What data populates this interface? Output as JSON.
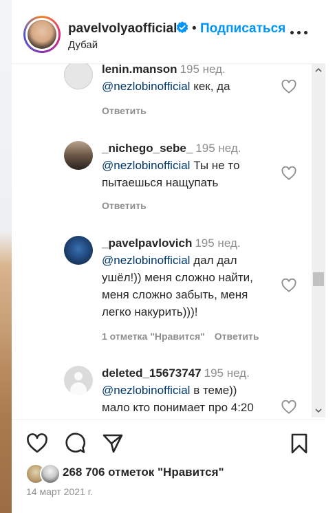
{
  "header": {
    "username": "pavelvolyaofficial",
    "separator": "•",
    "follow_label": "Подписаться",
    "location": "Дубай",
    "avatar_icon": "profile-avatar",
    "verified_icon": "verified-badge-icon",
    "more_icon": "more-options-icon"
  },
  "comments": [
    {
      "username": "lenin.manson",
      "time": "195 нед.",
      "mention": "@nezlobinofficial",
      "lines": [
        "кек, да"
      ],
      "likes": "",
      "reply_label": "Ответить"
    },
    {
      "username": "_nichego_sebe_",
      "time": "195 нед.",
      "mention": "@nezlobinofficial",
      "lines": [
        "Ты не то",
        "пытаешься нащупать"
      ],
      "likes": "",
      "reply_label": "Ответить"
    },
    {
      "username": "_pavelpavlovich",
      "time": "195 нед.",
      "mention": "@nezlobinofficial",
      "lines": [
        "дал дал",
        "ушёл!)) меня сложно найти,",
        "меня сложно забыть, меня",
        "легко накурить)))!"
      ],
      "likes": "1 отметка \"Нравится\"",
      "reply_label": "Ответить"
    },
    {
      "username": "deleted_15673747",
      "time": "195 нед.",
      "mention": "@nezlobinofficial",
      "lines": [
        "в теме))",
        "мало кто понимает про 4:20"
      ],
      "likes": "",
      "reply_label": ""
    }
  ],
  "actions": {
    "like_icon": "heart-icon",
    "comment_icon": "comment-icon",
    "share_icon": "share-icon",
    "save_icon": "bookmark-icon"
  },
  "likes_summary": "268 706 отметок \"Нравится\"",
  "date": "14 март 2021 г.",
  "colors": {
    "accent": "#0095f6",
    "mention": "#00376b",
    "muted": "#8e8e8e",
    "text": "#262626"
  }
}
